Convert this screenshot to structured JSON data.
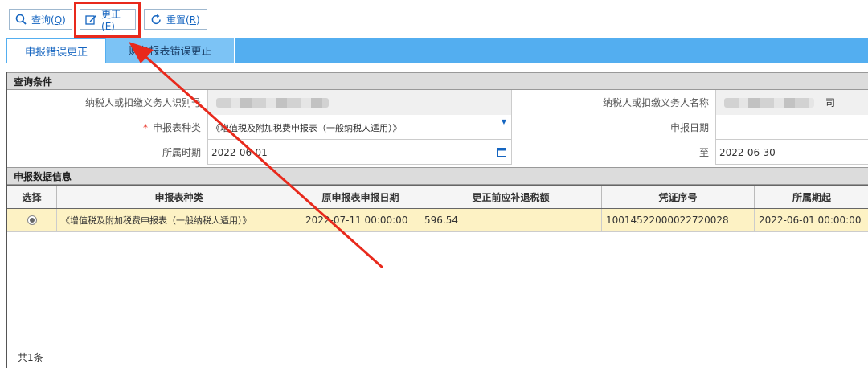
{
  "toolbar": {
    "query_label": "查询(",
    "query_key": "Q",
    "query_close": ")",
    "correct_label": "更正(",
    "correct_key": "E",
    "correct_close": ")",
    "reset_label": "重置(",
    "reset_key": "R",
    "reset_close": ")"
  },
  "tabs": [
    {
      "label": "申报错误更正",
      "active": true
    },
    {
      "label": "财务报表错误更正",
      "active": false
    }
  ],
  "query_section": {
    "title": "查询条件",
    "taxpayer_id_label": "纳税人或扣缴义务人识别号",
    "taxpayer_name_label": "纳税人或扣缴义务人名称",
    "taxpayer_name_suffix": "司",
    "report_type_label": "申报表种类",
    "report_type_value": "《增值税及附加税费申报表（一般纳税人适用）》",
    "declare_date_label": "申报日期",
    "period_label": "所属时期",
    "period_from": "2022-06-01",
    "period_to_label": "至",
    "period_to": "2022-06-30"
  },
  "data_section": {
    "title": "申报数据信息",
    "columns": [
      "选择",
      "申报表种类",
      "原申报表申报日期",
      "更正前应补退税额",
      "凭证序号",
      "所属期起"
    ],
    "rows": [
      {
        "report_type": "《增值税及附加税费申报表（一般纳税人适用）》",
        "orig_date": "2022-07-11 00:00:00",
        "tax_before": "596.54",
        "voucher_no": "10014522000022720028",
        "period_start": "2022-06-01 00:00:00"
      }
    ],
    "total": "共1条"
  },
  "colors": {
    "accent": "#1565c0",
    "tab_bar": "#53aef0",
    "selected_row": "#fdf2c4",
    "annotation": "#e8291c"
  }
}
